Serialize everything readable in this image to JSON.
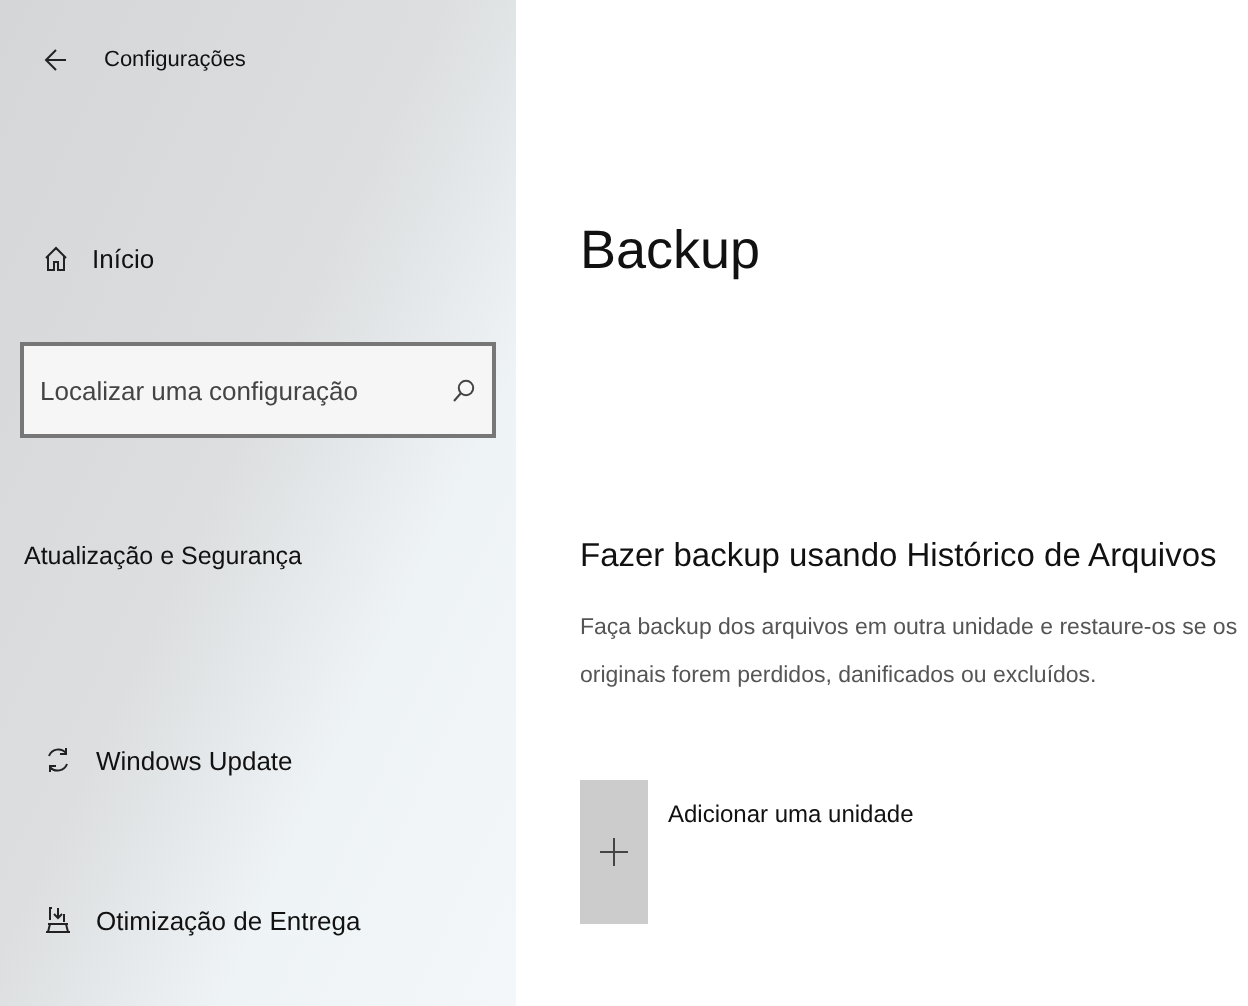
{
  "window": {
    "title": "Configurações"
  },
  "sidebar": {
    "home": "Início",
    "search": {
      "placeholder": "Localizar uma configuração"
    },
    "section": "Atualização e Segurança",
    "items": [
      {
        "label": "Windows Update",
        "kind": "sync"
      },
      {
        "label": "Otimização de Entrega",
        "kind": "delivery"
      }
    ]
  },
  "main": {
    "title": "Backup",
    "heading": "Fazer backup usando Histórico de Arquivos",
    "description": "Faça backup dos arquivos em outra unidade e restaure-os se os originais forem perdidos, danificados ou excluídos.",
    "add_drive": "Adicionar uma unidade"
  }
}
